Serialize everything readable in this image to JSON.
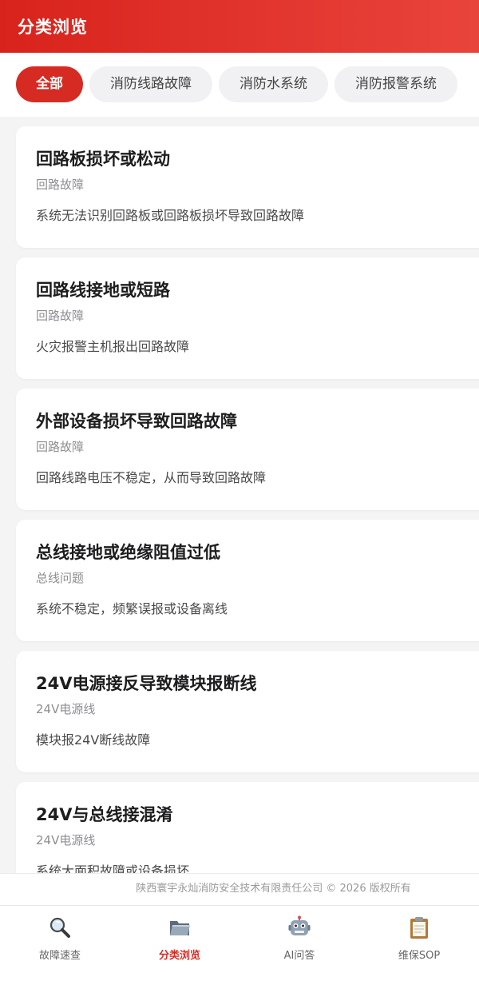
{
  "header": {
    "title": "分类浏览"
  },
  "tabs": [
    {
      "label": "全部",
      "active": true
    },
    {
      "label": "消防线路故障",
      "active": false
    },
    {
      "label": "消防水系统",
      "active": false
    },
    {
      "label": "消防报警系统",
      "active": false
    }
  ],
  "cards": [
    {
      "title": "回路板损坏或松动",
      "category": "回路故障",
      "description": "系统无法识别回路板或回路板损坏导致回路故障"
    },
    {
      "title": "回路线接地或短路",
      "category": "回路故障",
      "description": "火灾报警主机报出回路故障"
    },
    {
      "title": "外部设备损坏导致回路故障",
      "category": "回路故障",
      "description": "回路线路电压不稳定，从而导致回路故障"
    },
    {
      "title": "总线接地或绝缘阻值过低",
      "category": "总线问题",
      "description": "系统不稳定，频繁误报或设备离线"
    },
    {
      "title": "24V电源接反导致模块报断线",
      "category": "24V电源线",
      "description": "模块报24V断线故障"
    },
    {
      "title": "24V与总线接混淆",
      "category": "24V电源线",
      "description": "系统大面积故障或设备损坏"
    }
  ],
  "footer": {
    "copyright": "陕西寰宇永灿消防安全技术有限责任公司 © 2026 版权所有"
  },
  "bottom_nav": [
    {
      "label": "故障速查",
      "icon": "magnifier-icon",
      "active": false
    },
    {
      "label": "分类浏览",
      "icon": "folder-icon",
      "active": true
    },
    {
      "label": "AI问答",
      "icon": "robot-icon",
      "active": false
    },
    {
      "label": "维保SOP",
      "icon": "clipboard-icon",
      "active": false
    }
  ],
  "colors": {
    "accent": "#d62b23",
    "header_start": "#d8231c",
    "header_end": "#e9443c"
  }
}
